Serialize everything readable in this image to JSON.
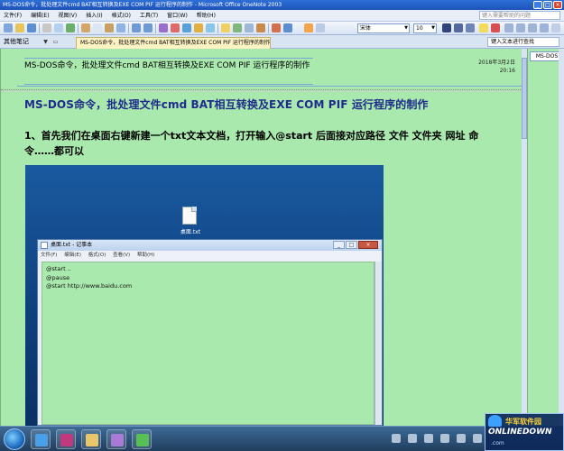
{
  "window": {
    "title": "MS-DOS命令，批处理文件cmd BAT相互转换及EXE COM PIF 运行程序的制作 - Microsoft Office OneNote 2003"
  },
  "menu": {
    "items": [
      "文件(F)",
      "编辑(E)",
      "视图(V)",
      "插入(I)",
      "格式(O)",
      "工具(T)",
      "窗口(W)",
      "帮助(H)"
    ],
    "help_search": "键入需要帮助的问题"
  },
  "toolbar": {
    "font_name": "宋体",
    "font_size": "10"
  },
  "tabs": {
    "notebook_name": "其他笔记",
    "page_tab": "MS-DOS命令，批处理文件cmd BAT相互转换及EXE COM PIF 运行程序的制作",
    "task_search": "键入文本进行查找"
  },
  "page": {
    "title": "MS-DOS命令，批处理文件cmd BAT相互转换及EXE COM PIF 运行程序的制作",
    "date": "2018年3月2日",
    "time": "20:16",
    "heading": "MS-DOS命令，批处理文件cmd BAT相互转换及EXE COM PIF 运行程序的制作",
    "step1": "1、首先我们在桌面右键新建一个txt文本文档，打开输入@start 后面接对应路径 文件 文件夹 网址 命令……都可以"
  },
  "page_list": {
    "items": [
      "MS-DOS"
    ]
  },
  "screenshot": {
    "desktop_file": "桌面.txt",
    "notepad": {
      "title": "桌面.txt - 记事本",
      "menu": [
        "文件(F)",
        "编辑(E)",
        "格式(O)",
        "查看(V)",
        "帮助(H)"
      ],
      "lines": [
        "@start ..",
        "@pause",
        "@start http://www.baidu.com"
      ]
    }
  },
  "watermark": {
    "cn": "华军软件园",
    "en": "ONLINEDOWN",
    "domain": ".com"
  },
  "colors": {
    "page_bg": "#a9e9ad",
    "heading": "#1e2a8c",
    "accent": "#1d52b8"
  }
}
